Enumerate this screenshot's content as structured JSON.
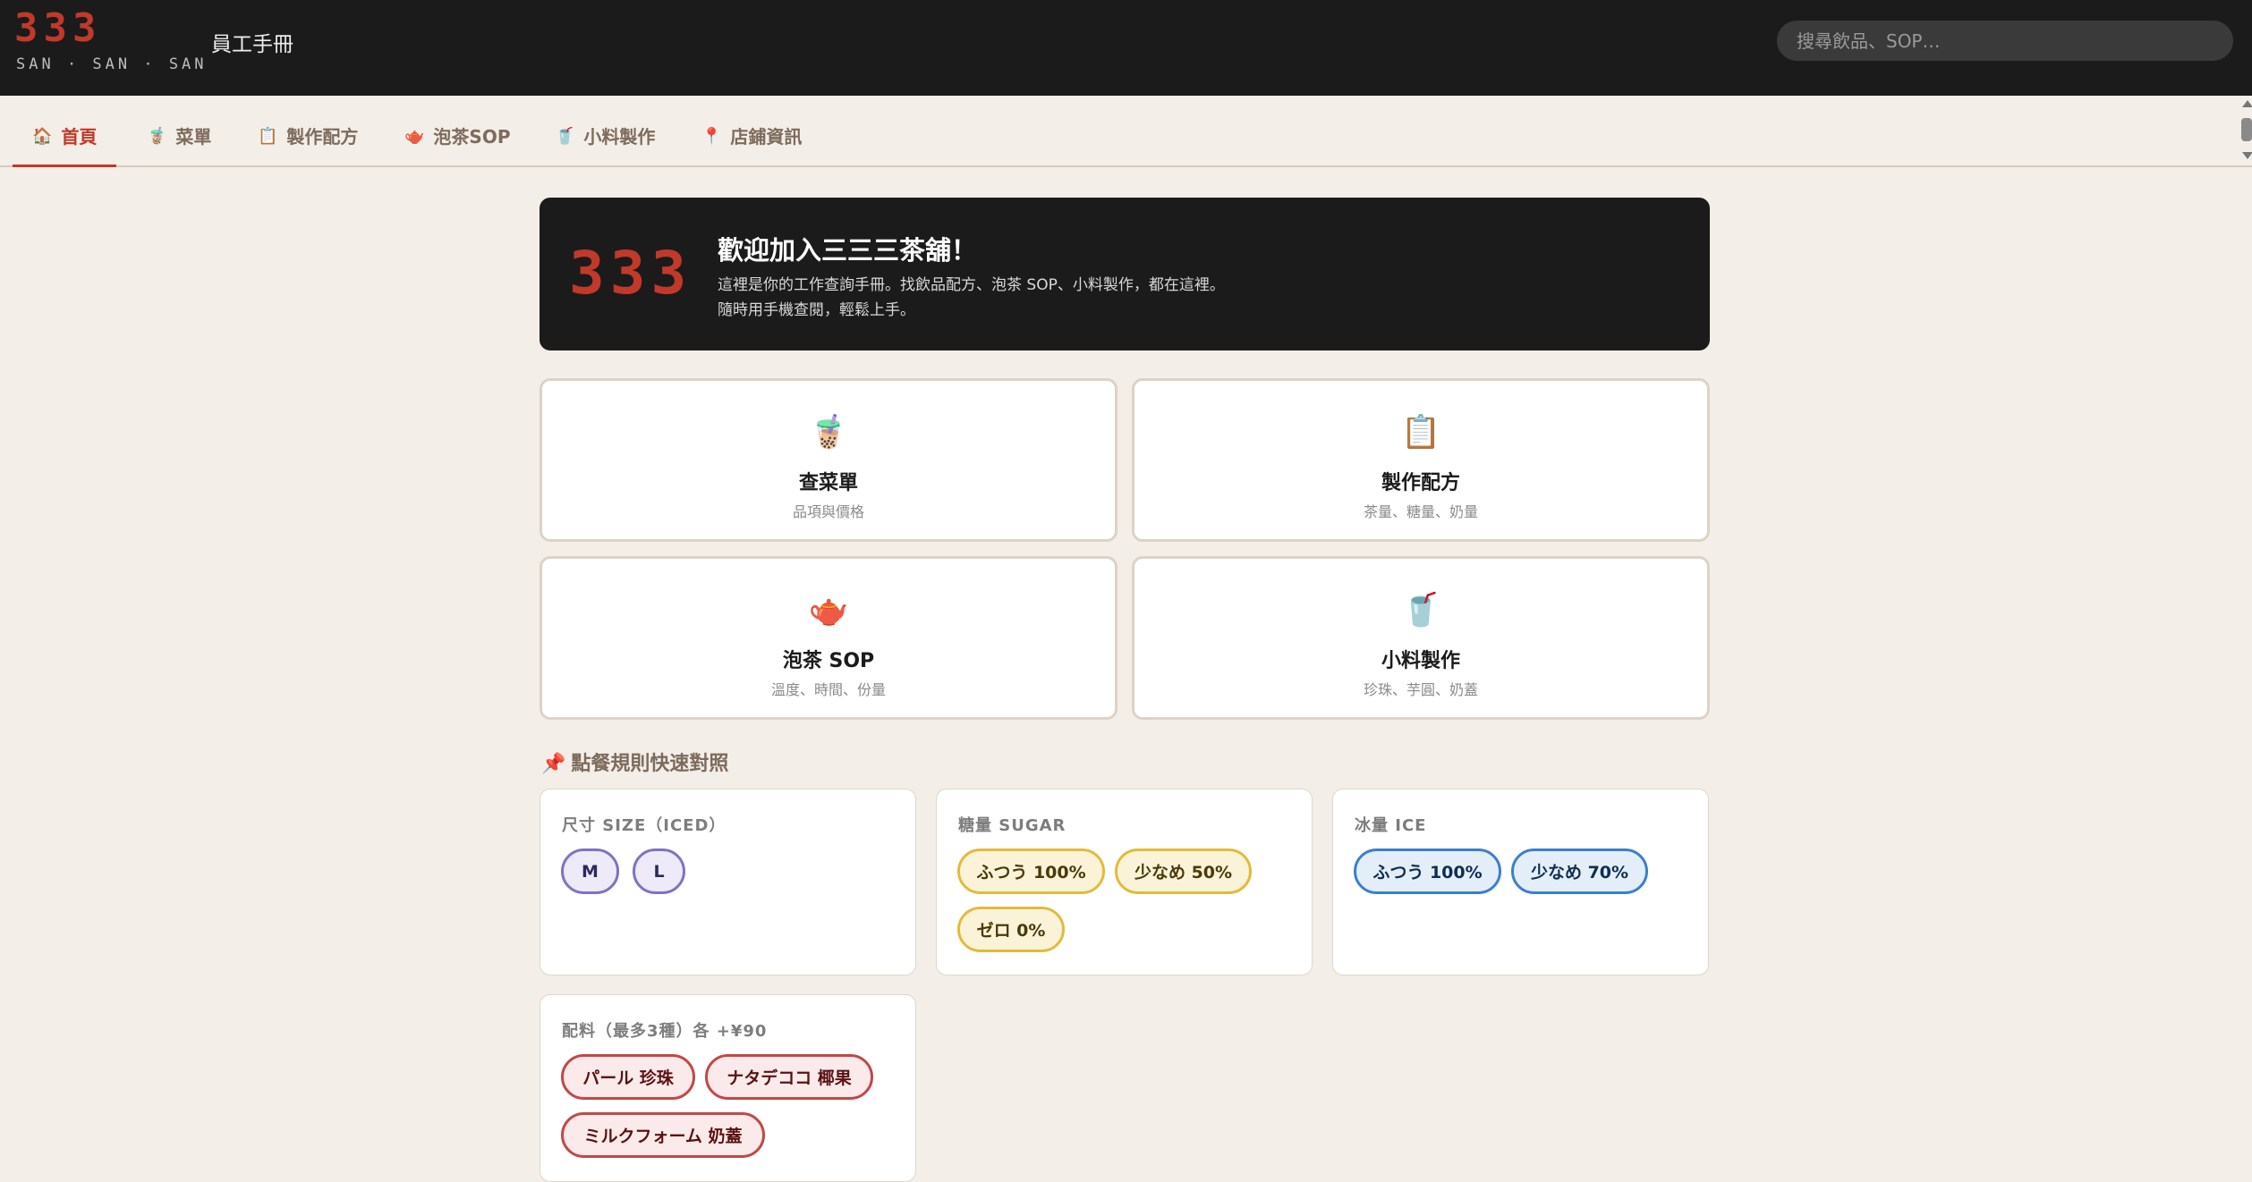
{
  "header": {
    "brand_number": "333",
    "brand_subtitle": "SAN · SAN · SAN",
    "title": "員工手冊",
    "search_placeholder": "搜尋飲品、SOP…"
  },
  "tabs": [
    {
      "icon": "🏠",
      "label": "首頁",
      "active": true
    },
    {
      "icon": "🧋",
      "label": "菜單"
    },
    {
      "icon": "📋",
      "label": "製作配方"
    },
    {
      "icon": "🫖",
      "label": "泡茶SOP"
    },
    {
      "icon": "🥤",
      "label": "小料製作"
    },
    {
      "icon": "📍",
      "label": "店鋪資訊"
    }
  ],
  "hero": {
    "number": "333",
    "title": "歡迎加入三三三茶舖！",
    "desc_line1": "這裡是你的工作查詢手冊。找飲品配方、泡茶 SOP、小料製作，都在這裡。",
    "desc_line2": "隨時用手機查閱，輕鬆上手。"
  },
  "quick_links": [
    {
      "icon": "🧋",
      "title": "查菜單",
      "subtitle": "品項與價格"
    },
    {
      "icon": "📋",
      "title": "製作配方",
      "subtitle": "茶量、糖量、奶量"
    },
    {
      "icon": "🫖",
      "title": "泡茶 SOP",
      "subtitle": "溫度、時間、份量"
    },
    {
      "icon": "🥤",
      "title": "小料製作",
      "subtitle": "珍珠、芋圓、奶蓋"
    }
  ],
  "rules": {
    "section_icon": "📌",
    "section_title": "點餐規則快速對照",
    "size": {
      "label": "尺寸 SIZE（ICED）",
      "options": [
        "M",
        "L"
      ]
    },
    "sugar": {
      "label": "糖量 SUGAR",
      "options": [
        "ふつう 100%",
        "少なめ 50%",
        "ゼロ 0%"
      ]
    },
    "ice": {
      "label": "冰量 ICE",
      "options": [
        "ふつう 100%",
        "少なめ 70%"
      ]
    },
    "toppings": {
      "label": "配料（最多3種）各 +¥90",
      "options": [
        "パール 珍珠",
        "ナタデココ 椰果",
        "ミルクフォーム 奶蓋"
      ]
    }
  },
  "colors": {
    "brand_red": "#c0392b",
    "dark_bg": "#1b1b1b",
    "page_bg": "#f3eee7",
    "size_chip": "#7e73c4",
    "sugar_chip": "#e2bb3a",
    "ice_chip": "#3b7fcc",
    "topping_chip": "#c24848"
  }
}
